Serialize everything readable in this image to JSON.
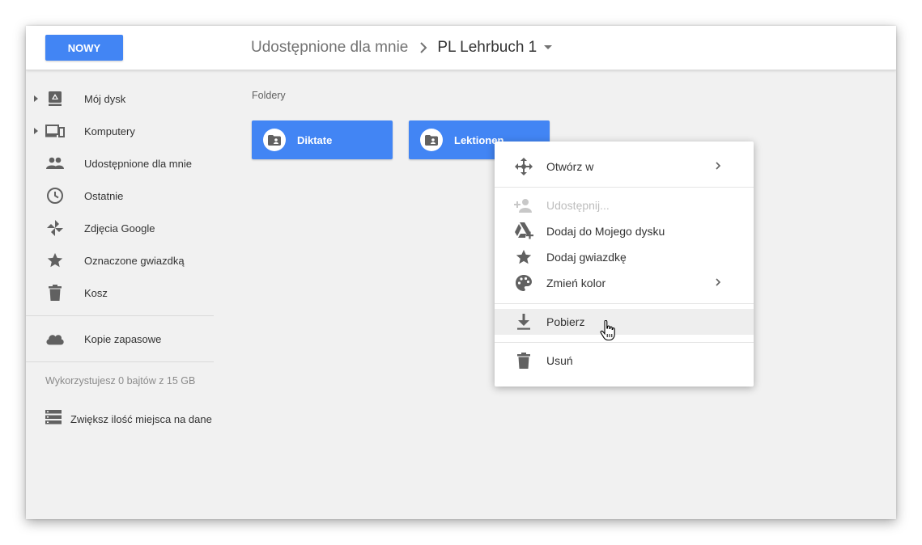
{
  "toolbar": {
    "new_label": "NOWY"
  },
  "breadcrumb": {
    "parent": "Udostępnione dla mnie",
    "current": "PL Lehrbuch 1"
  },
  "sidebar": {
    "items": [
      {
        "label": "Mój dysk",
        "icon": "my-drive-icon"
      },
      {
        "label": "Komputery",
        "icon": "computers-icon"
      },
      {
        "label": "Udostępnione dla mnie",
        "icon": "shared-people-icon"
      },
      {
        "label": "Ostatnie",
        "icon": "clock-icon"
      },
      {
        "label": "Zdjęcia Google",
        "icon": "pinwheel-icon"
      },
      {
        "label": "Oznaczone gwiazdką",
        "icon": "star-icon"
      },
      {
        "label": "Kosz",
        "icon": "trash-icon"
      }
    ],
    "backups": {
      "label": "Kopie zapasowe",
      "icon": "cloud-icon"
    },
    "quota": "Wykorzystujesz 0 bajtów z 15 GB",
    "upgrade": {
      "label": "Zwiększ ilość miejsca na dane",
      "icon": "storage-icon"
    }
  },
  "main": {
    "heading": "Foldery",
    "folders": [
      {
        "name": "Diktate",
        "icon": "shared-folder-icon"
      },
      {
        "name": "Lektionen",
        "icon": "shared-folder-icon"
      }
    ]
  },
  "context_menu": {
    "items": [
      {
        "label": "Otwórz w",
        "icon": "move-arrows-icon",
        "submenu": true
      },
      {
        "label": "Udostępnij...",
        "icon": "add-person-icon",
        "disabled": true
      },
      {
        "label": "Dodaj do Mojego dysku",
        "icon": "drive-add-icon"
      },
      {
        "label": "Dodaj gwiazdkę",
        "icon": "star-icon"
      },
      {
        "label": "Zmień kolor",
        "icon": "palette-icon",
        "submenu": true
      },
      {
        "label": "Pobierz",
        "icon": "download-icon",
        "hovered": true
      },
      {
        "label": "Usuń",
        "icon": "trash-icon"
      }
    ]
  },
  "colors": {
    "accent": "#4285f4",
    "icon": "#616161",
    "background": "#f1f1f1"
  }
}
